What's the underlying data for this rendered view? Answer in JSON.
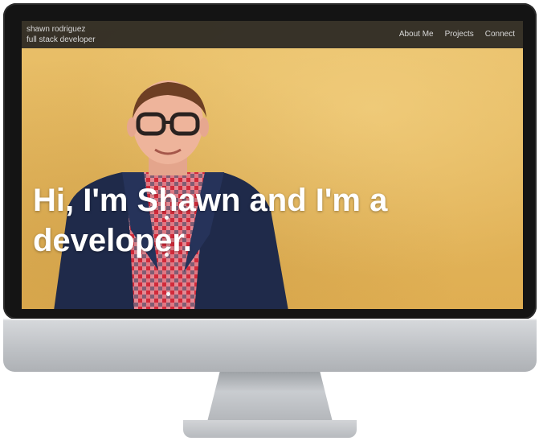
{
  "site": {
    "brand_name": "shawn rodriguez",
    "brand_tagline": "full stack developer"
  },
  "nav": {
    "items": [
      {
        "label": "About Me"
      },
      {
        "label": "Projects"
      },
      {
        "label": "Connect"
      }
    ]
  },
  "hero": {
    "headline_line1": "Hi, I'm Shawn and I'm a",
    "headline_line2": "developer."
  },
  "colors": {
    "wall": "#e7bd63",
    "navbar": "#1e1e1e",
    "bezel": "#141414",
    "jacket": "#1f2a4a",
    "shirt_red": "#d12a3a"
  }
}
